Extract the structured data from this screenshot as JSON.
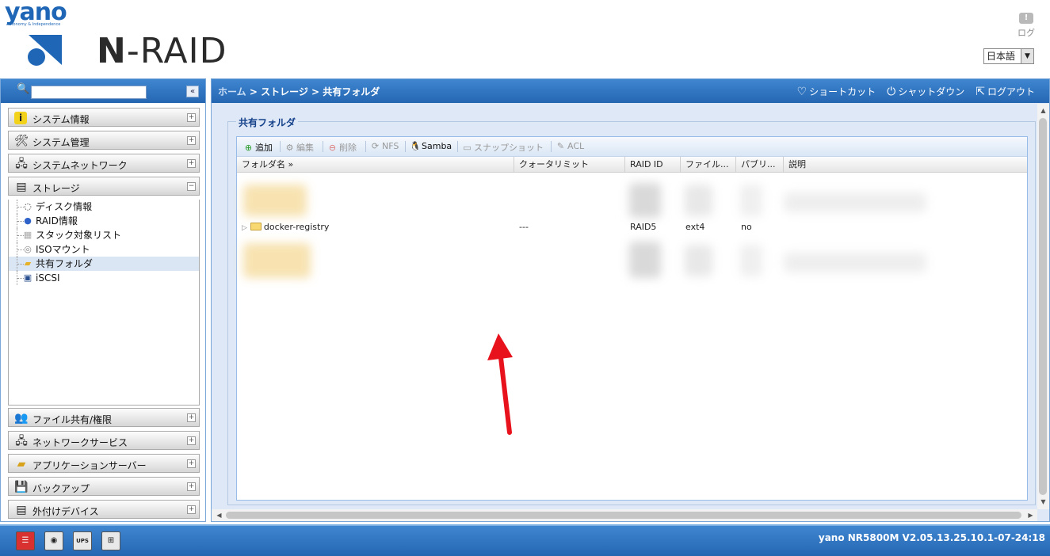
{
  "header": {
    "yano_word": "yano",
    "yano_tagline": "Autonomy & Independence",
    "product_name_n": "N",
    "product_name_rest": "-RAID",
    "log_label": "ログ",
    "language": "日本語"
  },
  "sidebar": {
    "search": {
      "value": "",
      "placeholder": ""
    },
    "collapse_icon": "«",
    "sections_top": [
      {
        "label": "システム情報",
        "icon": "info-icon"
      },
      {
        "label": "システム管理",
        "icon": "tools-icon"
      },
      {
        "label": "システムネットワーク",
        "icon": "network-icon"
      },
      {
        "label": "ストレージ",
        "icon": "storage-icon"
      }
    ],
    "storage_items": [
      {
        "label": "ディスク情報",
        "icon": "disk-icon"
      },
      {
        "label": "RAID情報",
        "icon": "raid-icon"
      },
      {
        "label": "スタック対象リスト",
        "icon": "stack-icon"
      },
      {
        "label": "ISOマウント",
        "icon": "iso-icon"
      },
      {
        "label": "共有フォルダ",
        "icon": "shared-folder-icon",
        "selected": true
      },
      {
        "label": "iSCSI",
        "icon": "iscsi-icon"
      }
    ],
    "sections_bottom": [
      {
        "label": "ファイル共有/権限",
        "icon": "users-icon"
      },
      {
        "label": "ネットワークサービス",
        "icon": "network-service-icon"
      },
      {
        "label": "アプリケーションサーバー",
        "icon": "app-server-icon"
      },
      {
        "label": "バックアップ",
        "icon": "backup-icon"
      },
      {
        "label": "外付けデバイス",
        "icon": "external-device-icon"
      }
    ]
  },
  "main": {
    "breadcrumb": {
      "home": "ホーム",
      "sep1": " > ",
      "storage": "ストレージ",
      "sep2": " > ",
      "current": "共有フォルダ"
    },
    "actions": {
      "shortcut": "ショートカット",
      "shutdown": "シャットダウン",
      "logout": "ログアウト"
    },
    "fieldset_title": "共有フォルダ",
    "toolbar": {
      "add": "追加",
      "edit": "編集",
      "delete": "削除",
      "nfs": "NFS",
      "samba": "Samba",
      "snapshot": "スナップショット",
      "acl": "ACL"
    },
    "columns": [
      "フォルダ名 »",
      "クォータリミット",
      "RAID ID",
      "ファイル...",
      "パブリ...",
      "説明"
    ],
    "rows": [
      {
        "name": "docker-registry",
        "quota": "---",
        "raid_id": "RAID5",
        "filesystem": "ext4",
        "public": "no",
        "description": ""
      }
    ]
  },
  "footer": {
    "buttons": [
      "server-icon",
      "disk-icon",
      "ups-icon",
      "network-icon"
    ],
    "ups_label": "UPS",
    "version": "yano NR5800M V2.05.13.25.10.1-07-24:18"
  },
  "colors": {
    "accent": "#2566b1",
    "highlight_arrow": "#e8121c"
  }
}
